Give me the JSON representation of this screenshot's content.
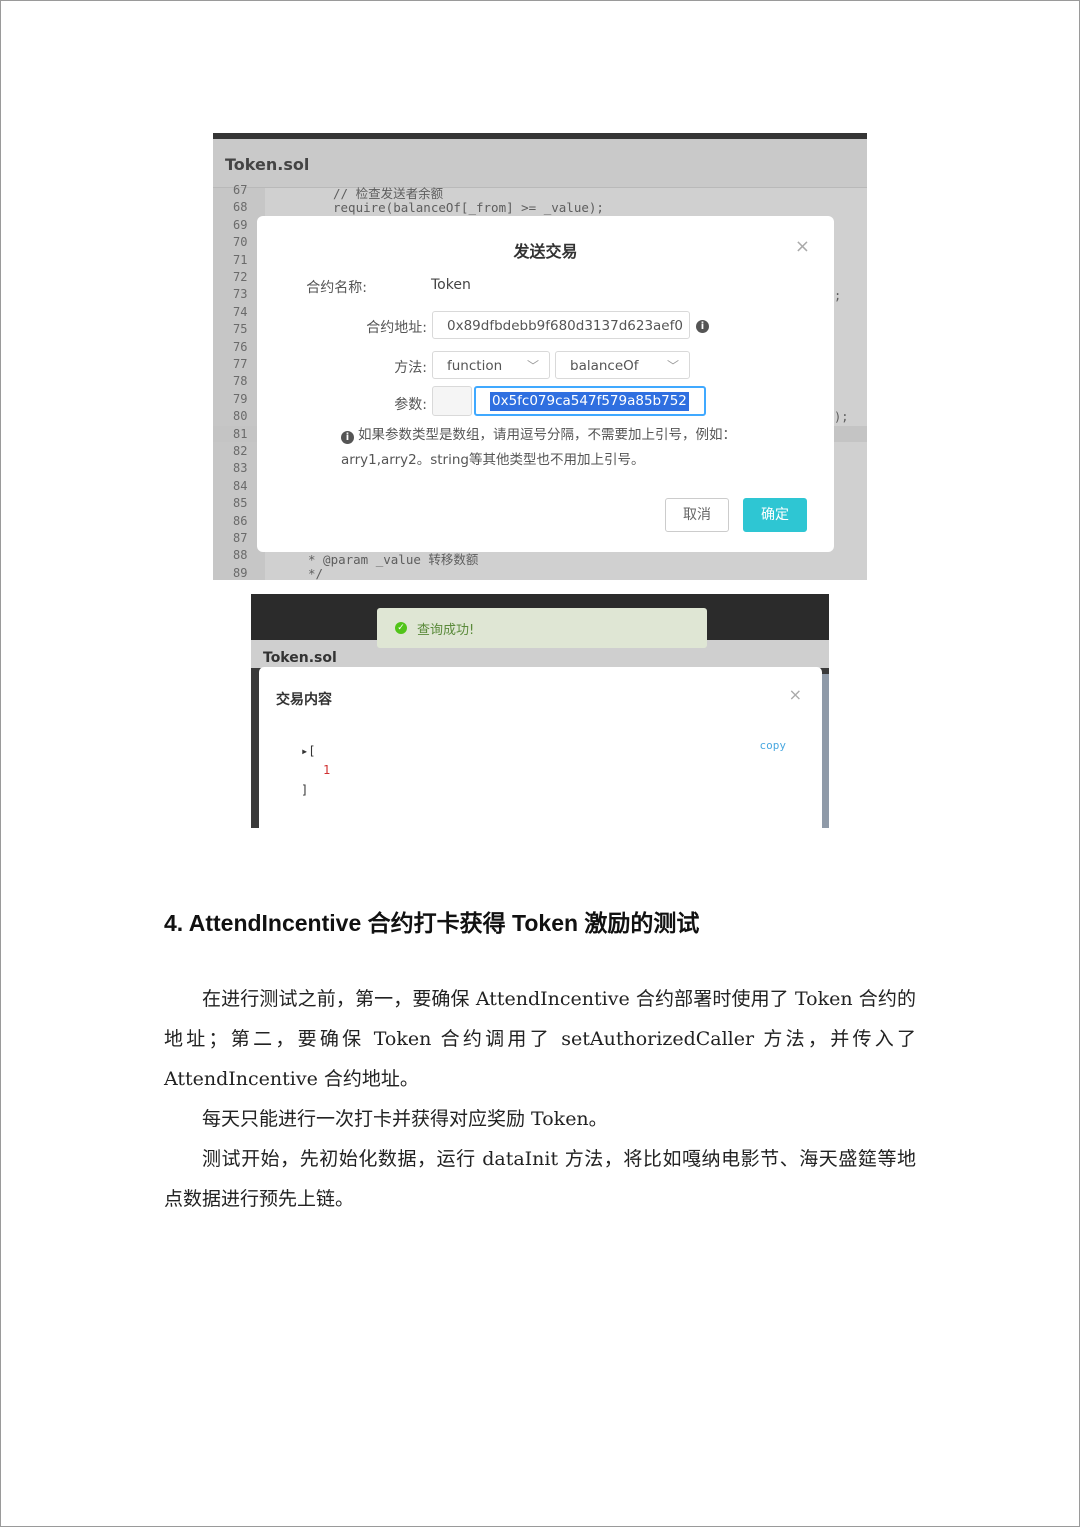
{
  "screenshot1": {
    "file_title": "Token.sol",
    "line_numbers": [
      "67",
      "68",
      "69",
      "70",
      "71",
      "72",
      "73",
      "74",
      "75",
      "76",
      "77",
      "78",
      "79",
      "80",
      "81",
      "82",
      "83",
      "84",
      "85",
      "86",
      "87",
      "88",
      "89"
    ],
    "code_top": "// 检查发送者余额",
    "code_require": "require(balanceOf[_from] >= _value);",
    "code_bottom1": "* @param _value 转移数额",
    "code_bottom2": "*/",
    "frag_semicolon": ";",
    "frag_paren": ");",
    "modal": {
      "title": "发送交易",
      "close": "×",
      "contract_name_label": "合约名称:",
      "contract_name_value": "Token",
      "contract_address_label": "合约地址:",
      "contract_address_value": "0x89dfbdebb9f680d3137d623aef0",
      "method_label": "方法:",
      "method_type": "function",
      "method_name": "balanceOf",
      "params_label": "参数:",
      "params_value": "0x5fc079ca547f579a85b752",
      "hint": "如果参数类型是数组，请用逗号分隔，不需要加上引号，例如：arry1,arry2。string等其他类型也不用加上引号。",
      "cancel_button": "取消",
      "confirm_button": "确定"
    }
  },
  "screenshot2": {
    "toast": "查询成功!",
    "file_title": "Token.sol",
    "modal_title": "交易内容",
    "close": "×",
    "copy": "copy",
    "json_open": "▸[",
    "json_value": "1",
    "json_close": "]"
  },
  "article": {
    "heading": "4. AttendIncentive 合约打卡获得 Token 激励的测试",
    "paragraph1": "在进行测试之前，第一，要确保 AttendIncentive 合约部署时使用了 Token 合约的地址；第二，要确保 Token 合约调用了 setAuthorizedCaller 方法，并传入了 AttendIncentive 合约地址。",
    "paragraph2": "每天只能进行一次打卡并获得对应奖励 Token。",
    "paragraph3": "测试开始，先初始化数据，运行 dataInit 方法，将比如嘎纳电影节、海天盛筵等地点数据进行预先上链。"
  }
}
